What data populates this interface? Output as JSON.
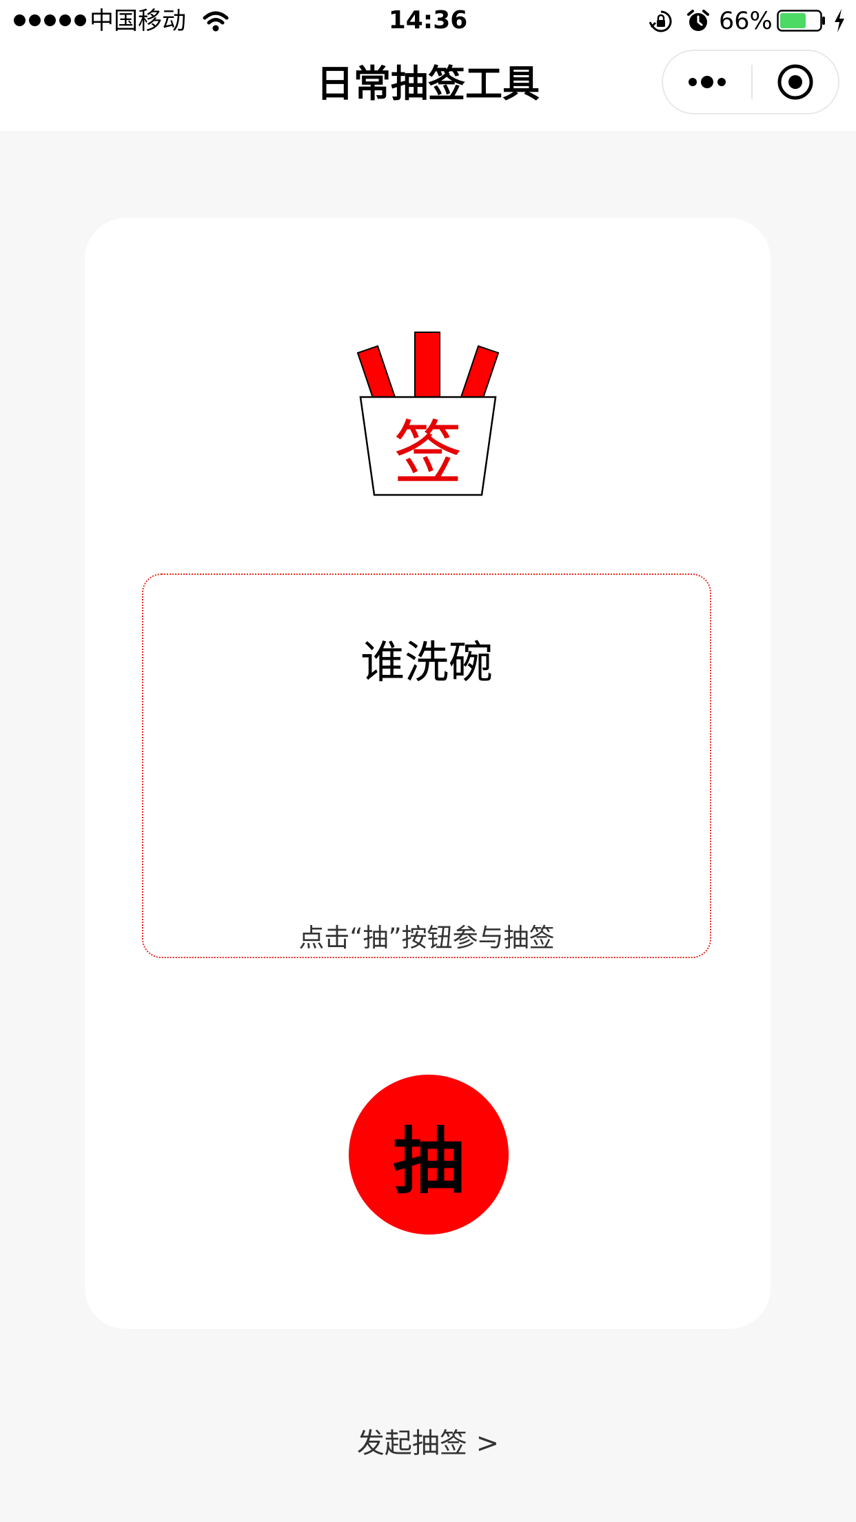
{
  "status_bar": {
    "carrier": "中国移动",
    "time": "14:36",
    "battery_percent": "66%",
    "battery_level": 0.66,
    "battery_color": "#4cd964"
  },
  "nav": {
    "title": "日常抽签工具",
    "more_icon": "more-dots-icon",
    "close_icon": "target-close-icon"
  },
  "card": {
    "bucket_char": "签",
    "topic": "谁洗碗",
    "hint": "点击“抽”按钮参与抽签",
    "draw_button_label": "抽",
    "accent_color": "#ff0000"
  },
  "footer": {
    "start_link": "发起抽签 >"
  }
}
